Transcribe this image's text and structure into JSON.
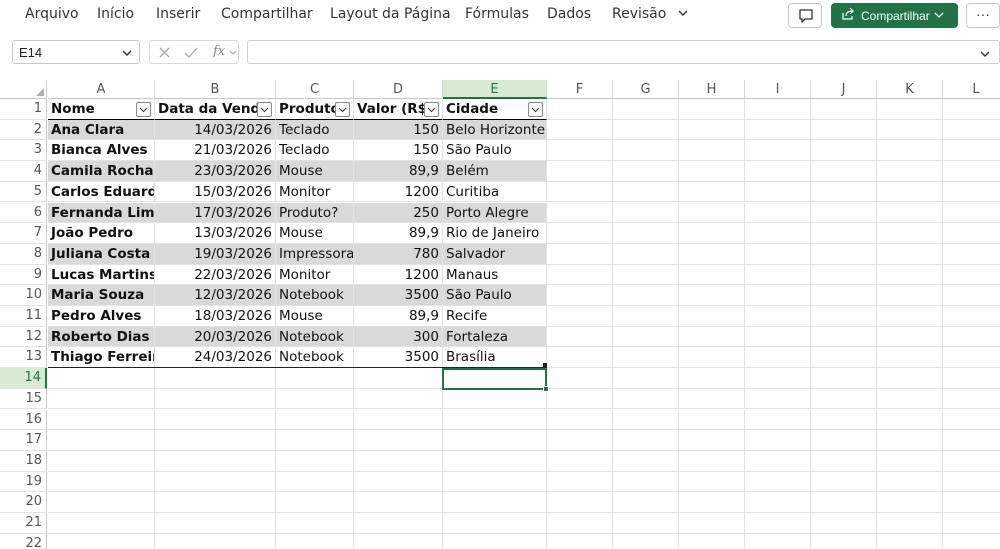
{
  "menu": {
    "items": [
      "Arquivo",
      "Início",
      "Inserir",
      "Compartilhar",
      "Layout da Página",
      "Fórmulas",
      "Dados",
      "Revisão"
    ],
    "share_label": "Compartilhar",
    "more_label": "···"
  },
  "formula_bar": {
    "name_box": "E14",
    "fx_label": "fx",
    "formula": ""
  },
  "columns": [
    "A",
    "B",
    "C",
    "D",
    "E",
    "F",
    "G",
    "H",
    "I",
    "J",
    "K",
    "L"
  ],
  "selected_column": "E",
  "selected_row": "14",
  "rows": [
    "1",
    "2",
    "3",
    "4",
    "5",
    "6",
    "7",
    "8",
    "9",
    "10",
    "11",
    "12",
    "13",
    "14",
    "15",
    "16",
    "17",
    "18",
    "19",
    "20",
    "21",
    "22"
  ],
  "table": {
    "headers": [
      "Nome",
      "Data da Venda",
      "Produto",
      "Valor (R$)",
      "Cidade"
    ],
    "data": [
      [
        "Ana Clara",
        "14/03/2026",
        "Teclado",
        "150",
        "Belo Horizonte"
      ],
      [
        "Bianca Alves",
        "21/03/2026",
        "Teclado",
        "150",
        "São Paulo"
      ],
      [
        "Camila Rocha",
        "23/03/2026",
        "Mouse",
        "89,9",
        "Belém"
      ],
      [
        "Carlos Eduardo",
        "15/03/2026",
        "Monitor",
        "1200",
        "Curitiba"
      ],
      [
        "Fernanda Lima",
        "17/03/2026",
        "Produto?",
        "250",
        "Porto Alegre"
      ],
      [
        "João Pedro",
        "13/03/2026",
        "Mouse",
        "89,9",
        "Rio de Janeiro"
      ],
      [
        "Juliana Costa",
        "19/03/2026",
        "Impressora",
        "780",
        "Salvador"
      ],
      [
        "Lucas Martins",
        "22/03/2026",
        "Monitor",
        "1200",
        "Manaus"
      ],
      [
        "Maria Souza",
        "12/03/2026",
        "Notebook",
        "3500",
        "São Paulo"
      ],
      [
        "Pedro Alves",
        "18/03/2026",
        "Mouse",
        "89,9",
        "Recife"
      ],
      [
        "Roberto Dias",
        "20/03/2026",
        "Notebook",
        "300",
        "Fortaleza"
      ],
      [
        "Thiago Ferreira",
        "24/03/2026",
        "Notebook",
        "3500",
        "Brasília"
      ]
    ]
  },
  "colors": {
    "accent": "#217346",
    "band": "#d9d9d9",
    "selected_header_bg": "#d9ead3"
  },
  "icons": [
    "chevron-down-icon",
    "comment-icon",
    "share-icon",
    "cancel-icon",
    "confirm-icon",
    "filter-dropdown-icon",
    "select-all-icon"
  ]
}
